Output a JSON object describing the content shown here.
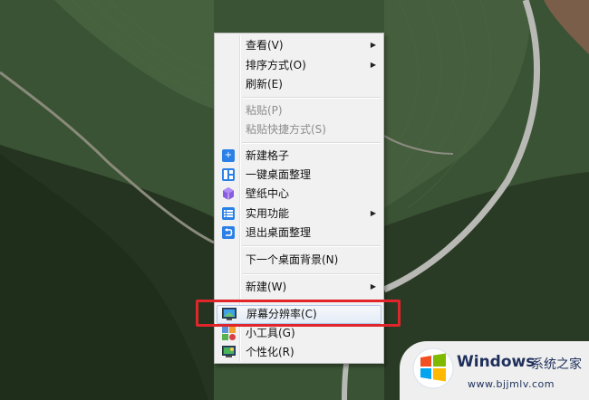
{
  "context_menu": {
    "items": [
      {
        "label": "查看(V)",
        "has_submenu": true,
        "enabled": true
      },
      {
        "label": "排序方式(O)",
        "has_submenu": true,
        "enabled": true
      },
      {
        "label": "刷新(E)",
        "has_submenu": false,
        "enabled": true
      },
      {
        "label": "粘贴(P)",
        "has_submenu": false,
        "enabled": false
      },
      {
        "label": "粘贴快捷方式(S)",
        "has_submenu": false,
        "enabled": false
      },
      {
        "label": "新建格子",
        "icon": "plus-icon",
        "enabled": true
      },
      {
        "label": "一键桌面整理",
        "icon": "layout-icon",
        "enabled": true
      },
      {
        "label": "壁纸中心",
        "icon": "cube-icon",
        "enabled": true
      },
      {
        "label": "实用功能",
        "icon": "list-icon",
        "has_submenu": true,
        "enabled": true
      },
      {
        "label": "退出桌面整理",
        "icon": "exit-icon",
        "enabled": true
      },
      {
        "label": "下一个桌面背景(N)",
        "enabled": true
      },
      {
        "label": "新建(W)",
        "has_submenu": true,
        "enabled": true
      },
      {
        "label": "屏幕分辨率(C)",
        "icon": "monitor-icon",
        "enabled": true,
        "highlighted": true
      },
      {
        "label": "小工具(G)",
        "icon": "gadgets-icon",
        "enabled": true
      },
      {
        "label": "个性化(R)",
        "icon": "personalize-icon",
        "enabled": true
      }
    ],
    "submenu_arrow": "▶"
  },
  "watermark": {
    "brand": "Windows",
    "brand_cn": "系统之家",
    "url": "www.bjjmlv.com"
  },
  "colors": {
    "highlight_box": "#e0262a",
    "menu_bg": "#f1f1f1",
    "icon_blue": "#2a80e6"
  }
}
